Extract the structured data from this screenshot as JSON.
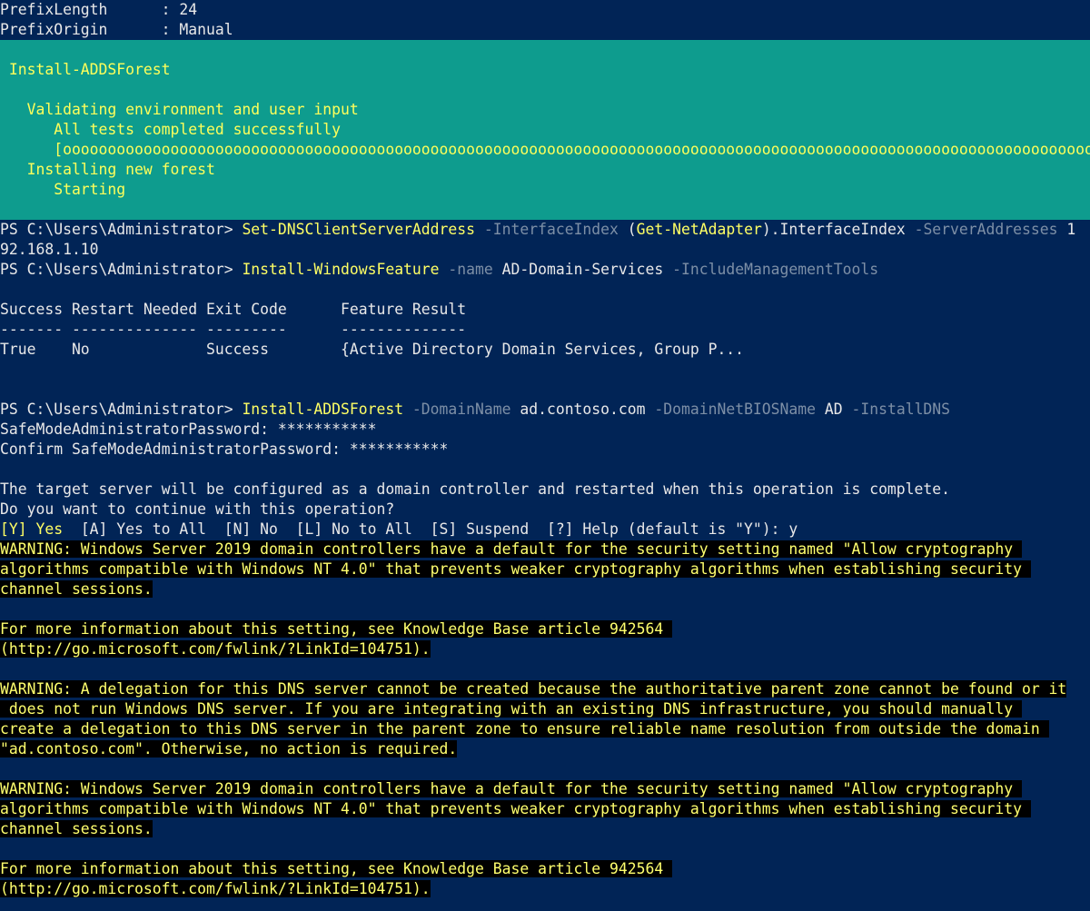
{
  "colors": {
    "background": "#012456",
    "progress_bg": "#0e9c8e",
    "command": "#ffff64",
    "parameter": "#7d8fa6",
    "warning_bg": "#000000",
    "warning_fg": "#ffff6e"
  },
  "top": {
    "prefix_length": "PrefixLength      : 24",
    "prefix_origin": "PrefixOrigin      : Manual"
  },
  "progress": {
    "activity": " Install-ADDSForest",
    "status1": "   Validating environment and user input",
    "status1_detail": "      All tests completed successfully",
    "bar": "      [ooooooooooooooooooooooooooooooooooooooooooooooooooooooooooooooooooooooooooooooooooooooooooooooooooooooooooooooooooo]",
    "status2": "   Installing new forest",
    "status2_detail": "      Starting"
  },
  "cmd1": {
    "prompt": "PS C:\\Users\\Administrator> ",
    "name": "Set-DNSClientServerAddress",
    "p1": " -InterfaceIndex",
    "a1_open": " (",
    "a1_cmd": "Get-NetAdapter",
    "a1_rest": ").InterfaceIndex",
    "p2": " -ServerAddresses",
    "a2": " 1",
    "wrap": "92.168.1.10"
  },
  "cmd2": {
    "prompt": "PS C:\\Users\\Administrator> ",
    "name": "Install-WindowsFeature",
    "p1": " -name",
    "a1": " AD-Domain-Services",
    "p2": " -IncludeManagementTools"
  },
  "feature_table": {
    "header": "Success Restart Needed Exit Code      Feature Result",
    "rule": "------- -------------- ---------      --------------",
    "row": "True    No             Success        {Active Directory Domain Services, Group P..."
  },
  "cmd3": {
    "prompt": "PS C:\\Users\\Administrator> ",
    "name": "Install-ADDSForest",
    "p1": " -DomainName",
    "a1": " ad.contoso.com",
    "p2": " -DomainNetBIOSName",
    "a2": " AD",
    "p3": " -InstallDNS",
    "safe_pw": "SafeModeAdministratorPassword: ***********",
    "confirm_pw": "Confirm SafeModeAdministratorPassword: ***********",
    "notice": "The target server will be configured as a domain controller and restarted when this operation is complete.",
    "question": "Do you want to continue with this operation?",
    "choice_yes": "[Y] Yes",
    "choice_rest": "  [A] Yes to All  [N] No  [L] No to All  [S] Suspend  [?] Help (default is \"Y\"): y"
  },
  "warnings": {
    "w1_l1": "WARNING: Windows Server 2019 domain controllers have a default for the security setting named \"Allow cryptography ",
    "w1_l2": "algorithms compatible with Windows NT 4.0\" that prevents weaker cryptography algorithms when establishing security ",
    "w1_l3": "channel sessions.",
    "kb1_l1": "For more information about this setting, see Knowledge Base article 942564 ",
    "kb1_l2": "(http://go.microsoft.com/fwlink/?LinkId=104751).",
    "w2_l1": "WARNING: A delegation for this DNS server cannot be created because the authoritative parent zone cannot be found or it",
    "w2_l2": " does not run Windows DNS server. If you are integrating with an existing DNS infrastructure, you should manually ",
    "w2_l3": "create a delegation to this DNS server in the parent zone to ensure reliable name resolution from outside the domain ",
    "w2_l4": "\"ad.contoso.com\". Otherwise, no action is required.",
    "w3_l1": "WARNING: Windows Server 2019 domain controllers have a default for the security setting named \"Allow cryptography ",
    "w3_l2": "algorithms compatible with Windows NT 4.0\" that prevents weaker cryptography algorithms when establishing security ",
    "w3_l3": "channel sessions.",
    "kb2_l1": "For more information about this setting, see Knowledge Base article 942564 ",
    "kb2_l2": "(http://go.microsoft.com/fwlink/?LinkId=104751)."
  }
}
